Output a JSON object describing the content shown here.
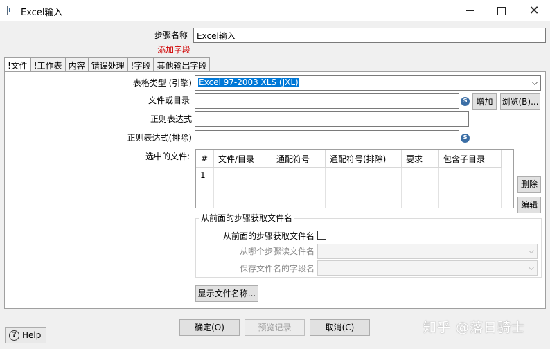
{
  "window": {
    "title": "Excel输入",
    "minimize_label": "",
    "maximize_label": "",
    "close_label": "✕"
  },
  "step": {
    "name_label": "步骤名称",
    "name_value": "Excel输入",
    "add_field_link": "添加字段"
  },
  "tabs": [
    {
      "label": "!文件"
    },
    {
      "label": "!工作表"
    },
    {
      "label": "内容"
    },
    {
      "label": "错误处理"
    },
    {
      "label": "!字段"
    },
    {
      "label": "其他输出字段"
    }
  ],
  "file_tab": {
    "spreadsheet_type_label": "表格类型 (引擎)",
    "spreadsheet_type_value": "Excel 97-2003 XLS (JXL)",
    "file_or_dir_label": "文件或目录",
    "file_or_dir_value": "",
    "add_button": "增加",
    "browse_button": "浏览(B)...",
    "regex_label": "正则表达式",
    "regex_value": "",
    "regex_exclude_label": "正则表达式(排除)",
    "regex_exclude_value": "",
    "selected_files_label": "选中的文件:",
    "delete_button": "删除",
    "edit_button": "编辑",
    "table": {
      "sort_glyph": "^",
      "headers": [
        "#",
        "文件/目录",
        "通配符号",
        "通配符号(排除)",
        "要求",
        "包含子目录"
      ],
      "rows": [
        [
          "1",
          "",
          "",
          "",
          "",
          ""
        ]
      ]
    },
    "from_prev": {
      "group_title": "从前面的步骤获取文件名",
      "checkbox_label": "从前面的步骤获取文件名",
      "checked": false,
      "read_step_label": "从哪个步骤读文件名",
      "read_step_value": "",
      "field_label": "保存文件名的字段名",
      "field_value": ""
    },
    "show_filenames_button": "显示文件名称..."
  },
  "footer": {
    "help_label": "Help",
    "ok_button": "确定(O)",
    "preview_button": "预览记录",
    "cancel_button": "取消(C)"
  },
  "watermark": "知乎 @落日骑士",
  "icons": {
    "app": "document-icon",
    "variable": "variable-diamond-icon",
    "help": "question-circle-icon"
  },
  "colors": {
    "selection": "#0078d7",
    "link_red": "#d00000",
    "variable_icon": "#3b6ea5"
  }
}
